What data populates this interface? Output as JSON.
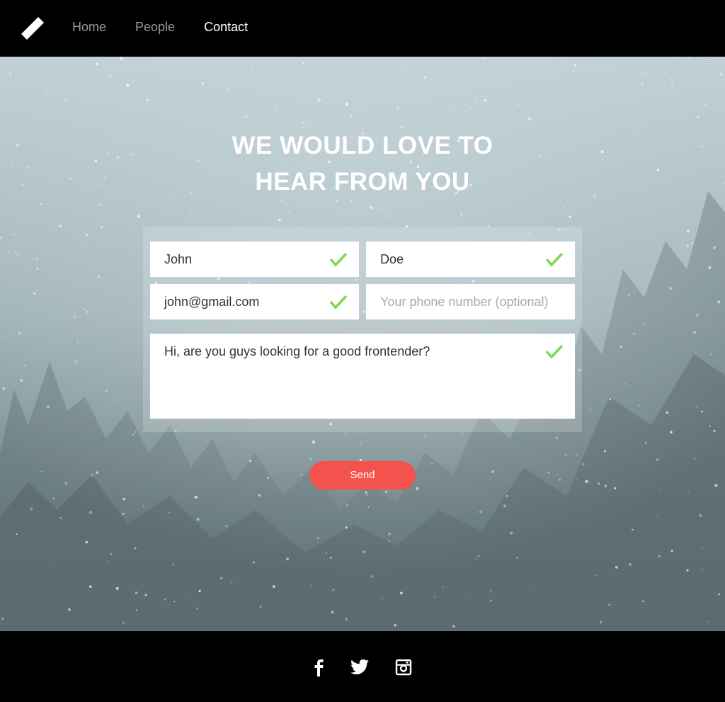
{
  "nav": {
    "items": [
      {
        "label": "Home",
        "active": false
      },
      {
        "label": "People",
        "active": false
      },
      {
        "label": "Contact",
        "active": true
      }
    ]
  },
  "hero": {
    "title_line1": "WE WOULD LOVE TO",
    "title_line2": "HEAR FROM YOU"
  },
  "form": {
    "first_name": "John",
    "last_name": "Doe",
    "email": "john@gmail.com",
    "phone_placeholder": "Your phone number (optional)",
    "message": "Hi, are you guys looking for a good frontender?",
    "send_label": "Send"
  },
  "footer": {
    "social": [
      "facebook-icon",
      "twitter-icon",
      "instagram-icon"
    ]
  },
  "colors": {
    "accent": "#f4524d",
    "check": "#7ed957",
    "bar": "#000000"
  }
}
